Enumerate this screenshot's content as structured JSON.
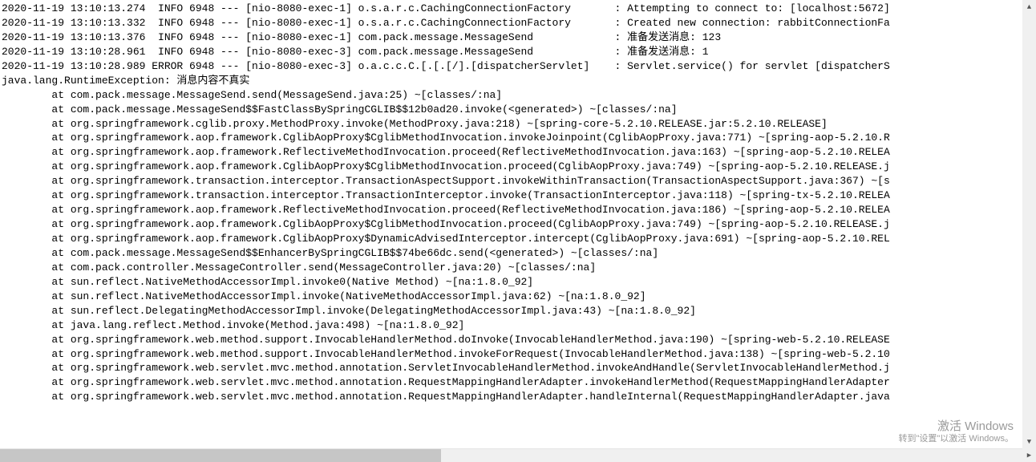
{
  "log": {
    "header_lines": [
      "2020-11-19 13:10:13.274  INFO 6948 --- [nio-8080-exec-1] o.s.a.r.c.CachingConnectionFactory       : Attempting to connect to: [localhost:5672]",
      "2020-11-19 13:10:13.332  INFO 6948 --- [nio-8080-exec-1] o.s.a.r.c.CachingConnectionFactory       : Created new connection: rabbitConnectionFa",
      "2020-11-19 13:10:13.376  INFO 6948 --- [nio-8080-exec-1] com.pack.message.MessageSend             : 准备发送消息: 123",
      "2020-11-19 13:10:28.961  INFO 6948 --- [nio-8080-exec-3] com.pack.message.MessageSend             : 准备发送消息: 1",
      "2020-11-19 13:10:28.989 ERROR 6948 --- [nio-8080-exec-3] o.a.c.c.C.[.[.[/].[dispatcherServlet]    : Servlet.service() for servlet [dispatcherS"
    ],
    "blank": "",
    "exception_header": "java.lang.RuntimeException: 消息内容不真实",
    "stack": [
      "at com.pack.message.MessageSend.send(MessageSend.java:25) ~[classes/:na]",
      "at com.pack.message.MessageSend$$FastClassBySpringCGLIB$$12b0ad20.invoke(<generated>) ~[classes/:na]",
      "at org.springframework.cglib.proxy.MethodProxy.invoke(MethodProxy.java:218) ~[spring-core-5.2.10.RELEASE.jar:5.2.10.RELEASE]",
      "at org.springframework.aop.framework.CglibAopProxy$CglibMethodInvocation.invokeJoinpoint(CglibAopProxy.java:771) ~[spring-aop-5.2.10.R",
      "at org.springframework.aop.framework.ReflectiveMethodInvocation.proceed(ReflectiveMethodInvocation.java:163) ~[spring-aop-5.2.10.RELEA",
      "at org.springframework.aop.framework.CglibAopProxy$CglibMethodInvocation.proceed(CglibAopProxy.java:749) ~[spring-aop-5.2.10.RELEASE.j",
      "at org.springframework.transaction.interceptor.TransactionAspectSupport.invokeWithinTransaction(TransactionAspectSupport.java:367) ~[s",
      "at org.springframework.transaction.interceptor.TransactionInterceptor.invoke(TransactionInterceptor.java:118) ~[spring-tx-5.2.10.RELEA",
      "at org.springframework.aop.framework.ReflectiveMethodInvocation.proceed(ReflectiveMethodInvocation.java:186) ~[spring-aop-5.2.10.RELEA",
      "at org.springframework.aop.framework.CglibAopProxy$CglibMethodInvocation.proceed(CglibAopProxy.java:749) ~[spring-aop-5.2.10.RELEASE.j",
      "at org.springframework.aop.framework.CglibAopProxy$DynamicAdvisedInterceptor.intercept(CglibAopProxy.java:691) ~[spring-aop-5.2.10.REL",
      "at com.pack.message.MessageSend$$EnhancerBySpringCGLIB$$74be66dc.send(<generated>) ~[classes/:na]",
      "at com.pack.controller.MessageController.send(MessageController.java:20) ~[classes/:na]",
      "at sun.reflect.NativeMethodAccessorImpl.invoke0(Native Method) ~[na:1.8.0_92]",
      "at sun.reflect.NativeMethodAccessorImpl.invoke(NativeMethodAccessorImpl.java:62) ~[na:1.8.0_92]",
      "at sun.reflect.DelegatingMethodAccessorImpl.invoke(DelegatingMethodAccessorImpl.java:43) ~[na:1.8.0_92]",
      "at java.lang.reflect.Method.invoke(Method.java:498) ~[na:1.8.0_92]",
      "at org.springframework.web.method.support.InvocableHandlerMethod.doInvoke(InvocableHandlerMethod.java:190) ~[spring-web-5.2.10.RELEASE",
      "at org.springframework.web.method.support.InvocableHandlerMethod.invokeForRequest(InvocableHandlerMethod.java:138) ~[spring-web-5.2.10",
      "at org.springframework.web.servlet.mvc.method.annotation.ServletInvocableHandlerMethod.invokeAndHandle(ServletInvocableHandlerMethod.j",
      "at org.springframework.web.servlet.mvc.method.annotation.RequestMappingHandlerAdapter.invokeHandlerMethod(RequestMappingHandlerAdapter",
      "at org.springframework.web.servlet.mvc.method.annotation.RequestMappingHandlerAdapter.handleInternal(RequestMappingHandlerAdapter.java"
    ],
    "stack_indent": "        "
  },
  "watermark": {
    "title": "激活 Windows",
    "sub": "转到\"设置\"以激活 Windows。"
  },
  "scroll": {
    "left_glyph": "◀",
    "right_glyph": "▶",
    "up_glyph": "▲",
    "down_glyph": "▼"
  }
}
